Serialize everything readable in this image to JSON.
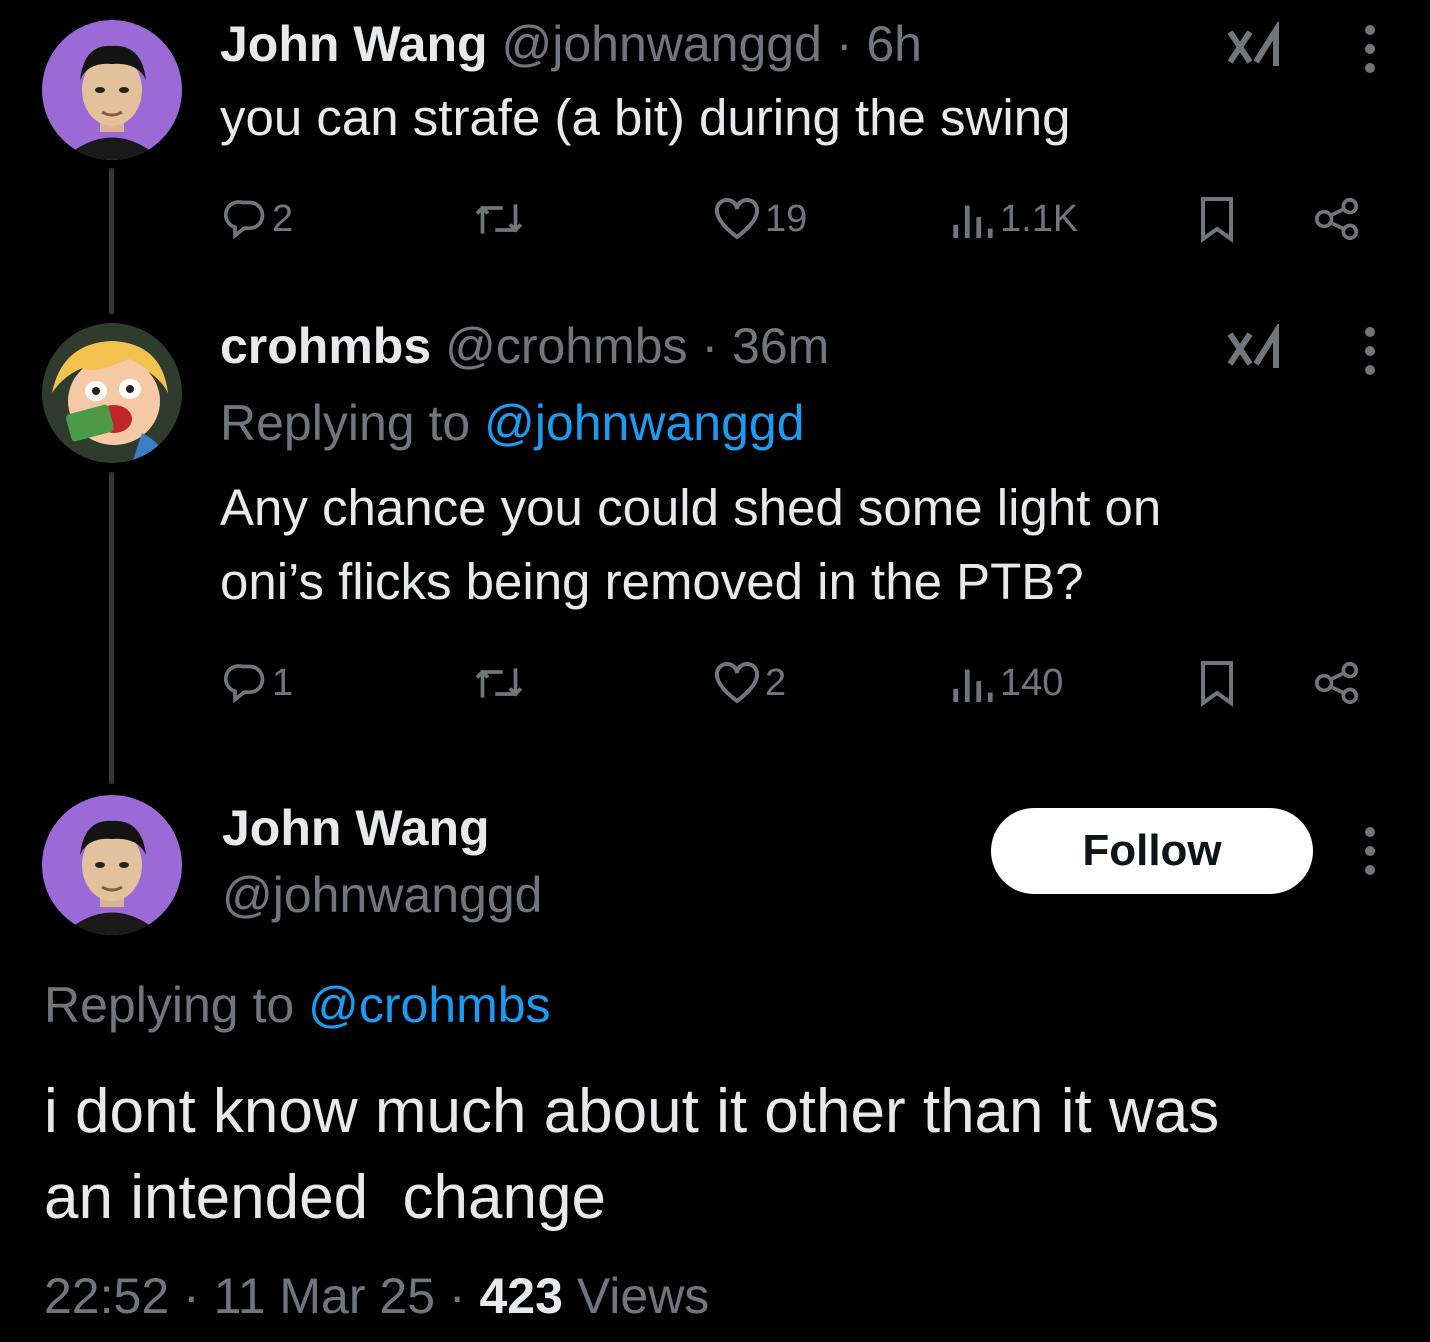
{
  "colors": {
    "background": "#000000",
    "text": "#e7e9ea",
    "muted": "#71767b",
    "link": "#1d9bf0",
    "avatar_john_bg": "#9b6ad6",
    "avatar_crohmbs_bg": "#2f3b2c"
  },
  "tweet1": {
    "name": "John Wang",
    "handle": "@johnwanggd",
    "separator": "·",
    "time": "6h",
    "text": "you can strafe (a bit) during the swing",
    "replies": "2",
    "likes": "19",
    "views": "1.1K",
    "icons": [
      "grok-icon",
      "more-icon",
      "reply-icon",
      "retweet-icon",
      "like-icon",
      "views-icon",
      "bookmark-icon",
      "share-icon"
    ]
  },
  "tweet2": {
    "name": "crohmbs",
    "handle": "@crohmbs",
    "separator": "·",
    "time": "36m",
    "replying_prefix": "Replying to",
    "replying_handle": "@johnwanggd",
    "text_line1": "Any chance you could shed some light on",
    "text_line2": "oni’s flicks being removed in the PTB?",
    "replies": "1",
    "likes": "2",
    "views": "140"
  },
  "main_tweet": {
    "name": "John Wang",
    "handle": "@johnwanggd",
    "follow_label": "Follow",
    "replying_prefix": "Replying to",
    "replying_handle": "@crohmbs",
    "text_line1": "i dont know much about it other than it was",
    "text_line2": "an intended  change",
    "time": "22:52",
    "date": "11 Mar 25",
    "separator": "·",
    "views_count": "423",
    "views_label": "Views"
  }
}
